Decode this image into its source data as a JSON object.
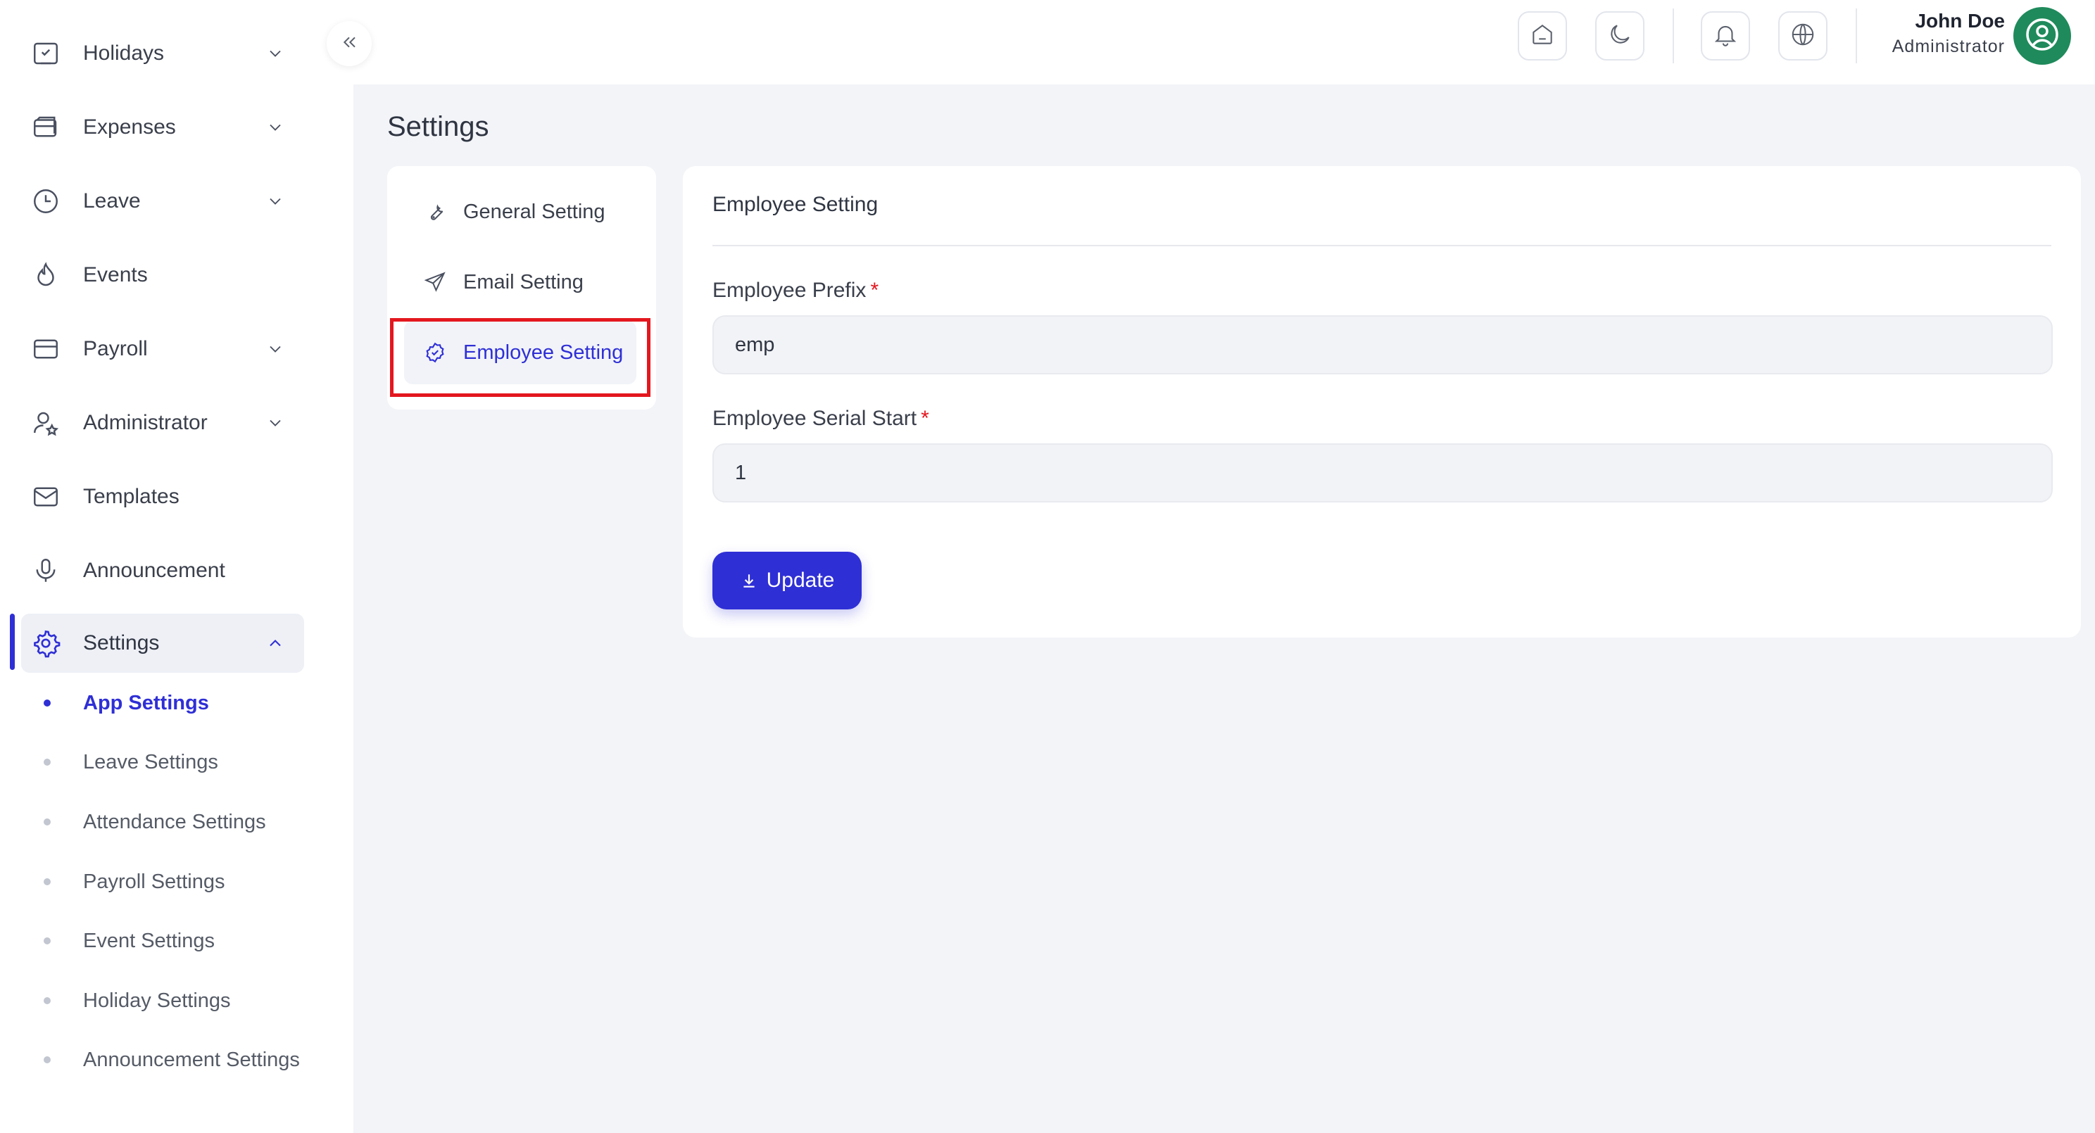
{
  "sidebar": {
    "items": [
      {
        "label": "Holidays",
        "icon": "calendar-check-icon",
        "has_children": true
      },
      {
        "label": "Expenses",
        "icon": "wallet-icon",
        "has_children": true
      },
      {
        "label": "Leave",
        "icon": "clock-icon",
        "has_children": true
      },
      {
        "label": "Events",
        "icon": "flame-icon",
        "has_children": false
      },
      {
        "label": "Payroll",
        "icon": "credit-card-icon",
        "has_children": true
      },
      {
        "label": "Administrator",
        "icon": "user-star-icon",
        "has_children": true
      },
      {
        "label": "Templates",
        "icon": "mail-icon",
        "has_children": false
      },
      {
        "label": "Announcement",
        "icon": "microphone-icon",
        "has_children": false
      },
      {
        "label": "Settings",
        "icon": "gear-icon",
        "has_children": true,
        "expanded": true,
        "active": true
      }
    ],
    "settings_subitems": [
      {
        "label": "App Settings",
        "active": true
      },
      {
        "label": "Leave Settings"
      },
      {
        "label": "Attendance Settings"
      },
      {
        "label": "Payroll Settings"
      },
      {
        "label": "Event Settings"
      },
      {
        "label": "Holiday Settings"
      },
      {
        "label": "Announcement Settings"
      }
    ]
  },
  "header": {
    "icons": [
      "home-icon",
      "moon-icon",
      "bell-icon",
      "globe-icon"
    ],
    "user": {
      "name": "John Doe",
      "role": "Administrator"
    }
  },
  "page": {
    "title": "Settings"
  },
  "settings_menu": {
    "items": [
      {
        "label": "General Setting",
        "icon": "wrench-icon"
      },
      {
        "label": "Email Setting",
        "icon": "send-icon"
      },
      {
        "label": "Employee Setting",
        "icon": "badge-check-icon",
        "active": true
      }
    ]
  },
  "form": {
    "title": "Employee Setting",
    "prefix_label": "Employee Prefix",
    "prefix_value": "emp",
    "serial_label": "Employee Serial Start",
    "serial_value": "1",
    "required_mark": "*",
    "update_label": "Update"
  },
  "colors": {
    "accent": "#2f2fd6",
    "highlight": "#e3171f",
    "avatar_bg": "#1f8a5b",
    "page_bg": "#f3f4f8"
  }
}
